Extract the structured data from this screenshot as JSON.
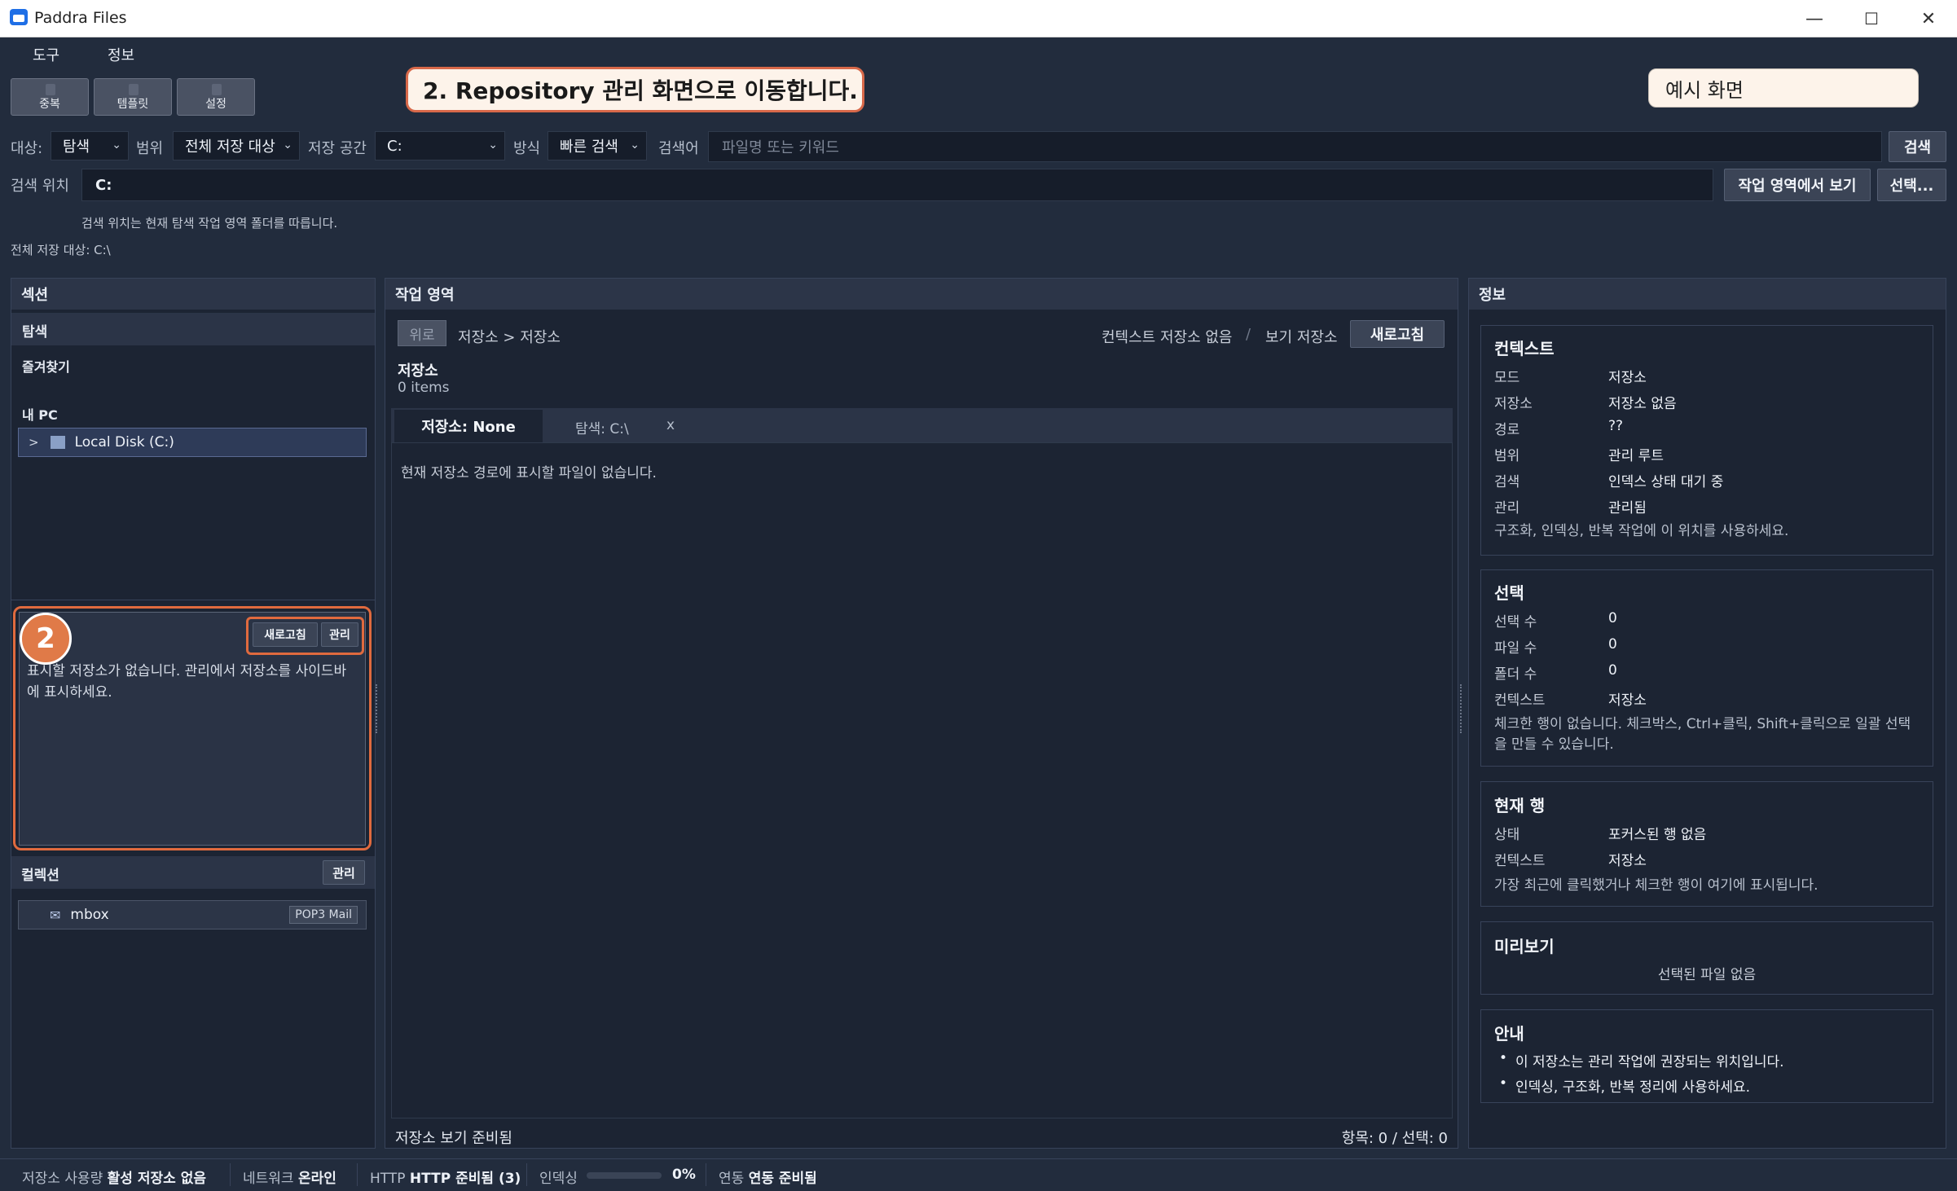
{
  "window": {
    "title": "Paddra Files"
  },
  "menu": [
    "도구",
    "정보"
  ],
  "toolbar": [
    "중복",
    "템플릿",
    "설정"
  ],
  "callout": "2. Repository 관리 화면으로 이동합니다.",
  "example_label": "예시 화면",
  "search_bar": {
    "target_label": "대상:",
    "target_value": "탐색",
    "scope_label": "범위",
    "scope_value": "전체 저장 대상",
    "storage_label": "저장 공간",
    "storage_value": "C:",
    "method_label": "방식",
    "method_value": "빠른 검색",
    "keyword_label": "검색어",
    "keyword_placeholder": "파일명 또는 키워드",
    "search_button": "검색",
    "location_label": "검색 위치",
    "location_value": "C:",
    "view_in_workspace_button": "작업 영역에서 보기",
    "select_button": "선택...",
    "location_hint": "검색 위치는 현재 탐색 작업 영역 폴더를 따릅니다.",
    "all_targets": "전체 저장 대상: C:\\"
  },
  "left": {
    "header": "섹션",
    "explore": "탐색",
    "favorites": "즐겨찾기",
    "my_pc": "내 PC",
    "disk": "Local Disk (C:)",
    "disk_arrow": ">",
    "repo_refresh": "새로고침",
    "repo_manage": "관리",
    "repo_empty": "표시할 저장소가 없습니다. 관리에서 저장소를 사이드바에 표시하세요.",
    "badge": "2",
    "collections_header": "컬렉션",
    "collections_manage": "관리",
    "collection_item": "mbox",
    "collection_tag": "POP3 Mail"
  },
  "center": {
    "header": "작업 영역",
    "up_button": "위로",
    "breadcrumb": "저장소 > 저장소",
    "no_context": "컨텍스트 저장소 없음",
    "separator": "/",
    "view_storage": "보기 저장소",
    "refresh_button": "새로고침",
    "title": "저장소",
    "count": "0 items",
    "tab1": "저장소: None",
    "tab2": "탐색: C:\\",
    "tab_close": "x",
    "empty": "현재 저장소 경로에 표시할 파일이 없습니다.",
    "status_left": "저장소 보기 준비됨",
    "status_right": "항목: 0 / 선택: 0"
  },
  "right": {
    "header": "정보",
    "context": {
      "title": "컨텍스트",
      "rows": [
        [
          "모드",
          "저장소"
        ],
        [
          "저장소",
          "저장소 없음"
        ],
        [
          "경로",
          "??"
        ],
        [
          "범위",
          "관리 루트"
        ],
        [
          "검색",
          "인덱스 상태 대기 중"
        ],
        [
          "관리",
          "관리됨"
        ]
      ],
      "note": "구조화, 인덱싱, 반복 작업에 이 위치를 사용하세요."
    },
    "selection": {
      "title": "선택",
      "rows": [
        [
          "선택 수",
          "0"
        ],
        [
          "파일 수",
          "0"
        ],
        [
          "폴더 수",
          "0"
        ],
        [
          "컨텍스트",
          "저장소"
        ]
      ],
      "note": "체크한 행이 없습니다. 체크박스, Ctrl+클릭, Shift+클릭으로 일괄 선택을 만들 수 있습니다."
    },
    "current_row": {
      "title": "현재 행",
      "rows": [
        [
          "상태",
          "포커스된 행 없음"
        ],
        [
          "컨텍스트",
          "저장소"
        ]
      ],
      "note": "가장 최근에 클릭했거나 체크한 행이 여기에 표시됩니다."
    },
    "preview": {
      "title": "미리보기",
      "empty": "선택된 파일 없음"
    },
    "guide": {
      "title": "안내",
      "items": [
        "이 저장소는 관리 작업에 권장되는 위치입니다.",
        "인덱싱, 구조화, 반복 정리에 사용하세요."
      ]
    }
  },
  "statusbar": {
    "storage_label": "저장소 사용량",
    "storage_value": "활성 저장소 없음",
    "network_label": "네트워크",
    "network_value": "온라인",
    "http_label": "HTTP",
    "http_value": "HTTP 준비됨 (3)",
    "index_label": "인덱싱",
    "index_percent": "0%",
    "sync_label": "연동",
    "sync_value": "연동 준비됨"
  }
}
